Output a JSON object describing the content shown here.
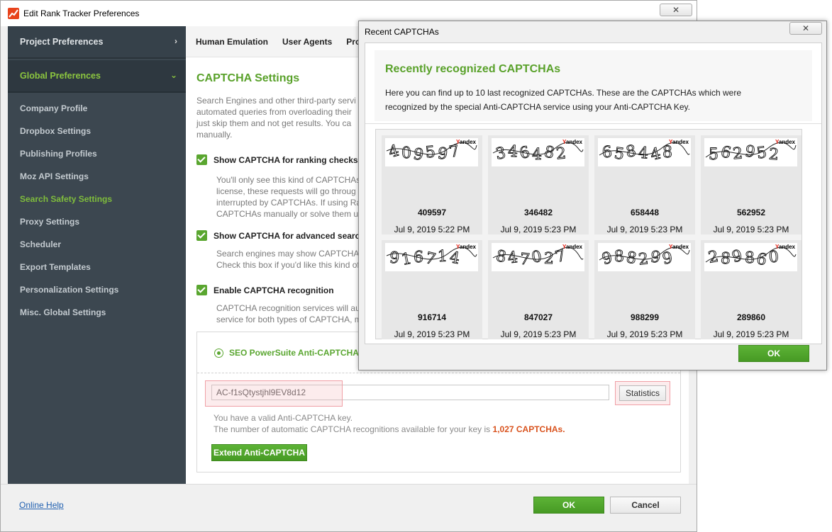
{
  "main_window": {
    "title": "Edit Rank Tracker Preferences",
    "close_label": "✕"
  },
  "sidebar": {
    "project_section": "Project Preferences",
    "global_section": "Global Preferences",
    "items": [
      {
        "label": "Company Profile"
      },
      {
        "label": "Dropbox Settings"
      },
      {
        "label": "Publishing Profiles"
      },
      {
        "label": "Moz API Settings"
      },
      {
        "label": "Search Safety Settings"
      },
      {
        "label": "Proxy Settings"
      },
      {
        "label": "Scheduler"
      },
      {
        "label": "Export Templates"
      },
      {
        "label": "Personalization Settings"
      },
      {
        "label": "Misc. Global Settings"
      }
    ]
  },
  "tabs": [
    "Human Emulation",
    "User Agents",
    "Pro"
  ],
  "captcha_settings": {
    "title": "CAPTCHA Settings",
    "description": "Search Engines and other third-party servi automated queries from overloading their just skip them and not get results. You ca manually.",
    "option1_label": "Show CAPTCHA for ranking checks i",
    "option1_desc": "You'll only see this kind of CAPTCHAs license, these requests will go throug interrupted by CAPTCHAs. If using Ra CAPTCHAs manually or solve them u",
    "option2_label": "Show CAPTCHA for advanced search",
    "option2_desc": "Search engines may show CAPTCHA Check this box if you'd like this kind of",
    "option3_label": "Enable CAPTCHA recognition",
    "option3_desc": "CAPTCHA recognition services will au service for both types of CAPTCHA, m",
    "radio_label": "SEO PowerSuite Anti-CAPTCHA",
    "key_value": "AC-f1sQtystjhl9EV8d12",
    "statistics_label": "Statistics",
    "valid_text": "You have a valid Anti-CAPTCHA key.",
    "avail_prefix": "The number of automatic CAPTCHA recognitions available for your key is ",
    "avail_value": "1,027 CAPTCHAs.",
    "extend_label": "Extend Anti-CAPTCHA"
  },
  "footer": {
    "help_label": "Online Help",
    "ok_label": "OK",
    "cancel_label": "Cancel"
  },
  "dialog": {
    "title": "Recent CAPTCHAs",
    "close_label": "✕",
    "heading": "Recently recognized CAPTCHAs",
    "description": "Here you can find up to 10 last recognized CAPTCHAs. These are the CAPTCHAs which were recognized by the special Anti-CAPTCHA service using your Anti-CAPTCHA Key.",
    "ok_label": "OK",
    "yandex_label": "Yandex",
    "captchas": [
      {
        "code": "409597",
        "date": "Jul 9, 2019 5:22 PM"
      },
      {
        "code": "346482",
        "date": "Jul 9, 2019 5:23 PM"
      },
      {
        "code": "658448",
        "date": "Jul 9, 2019 5:23 PM"
      },
      {
        "code": "562952",
        "date": "Jul 9, 2019 5:23 PM"
      },
      {
        "code": "916714",
        "date": "Jul 9, 2019 5:23 PM"
      },
      {
        "code": "847027",
        "date": "Jul 9, 2019 5:23 PM"
      },
      {
        "code": "988299",
        "date": "Jul 9, 2019 5:23 PM"
      },
      {
        "code": "289860",
        "date": "Jul 9, 2019 5:23 PM"
      }
    ]
  },
  "colors": {
    "accent_green": "#59a12a",
    "sidebar_bg": "#3c4750",
    "highlight_orange": "#d9531e"
  }
}
